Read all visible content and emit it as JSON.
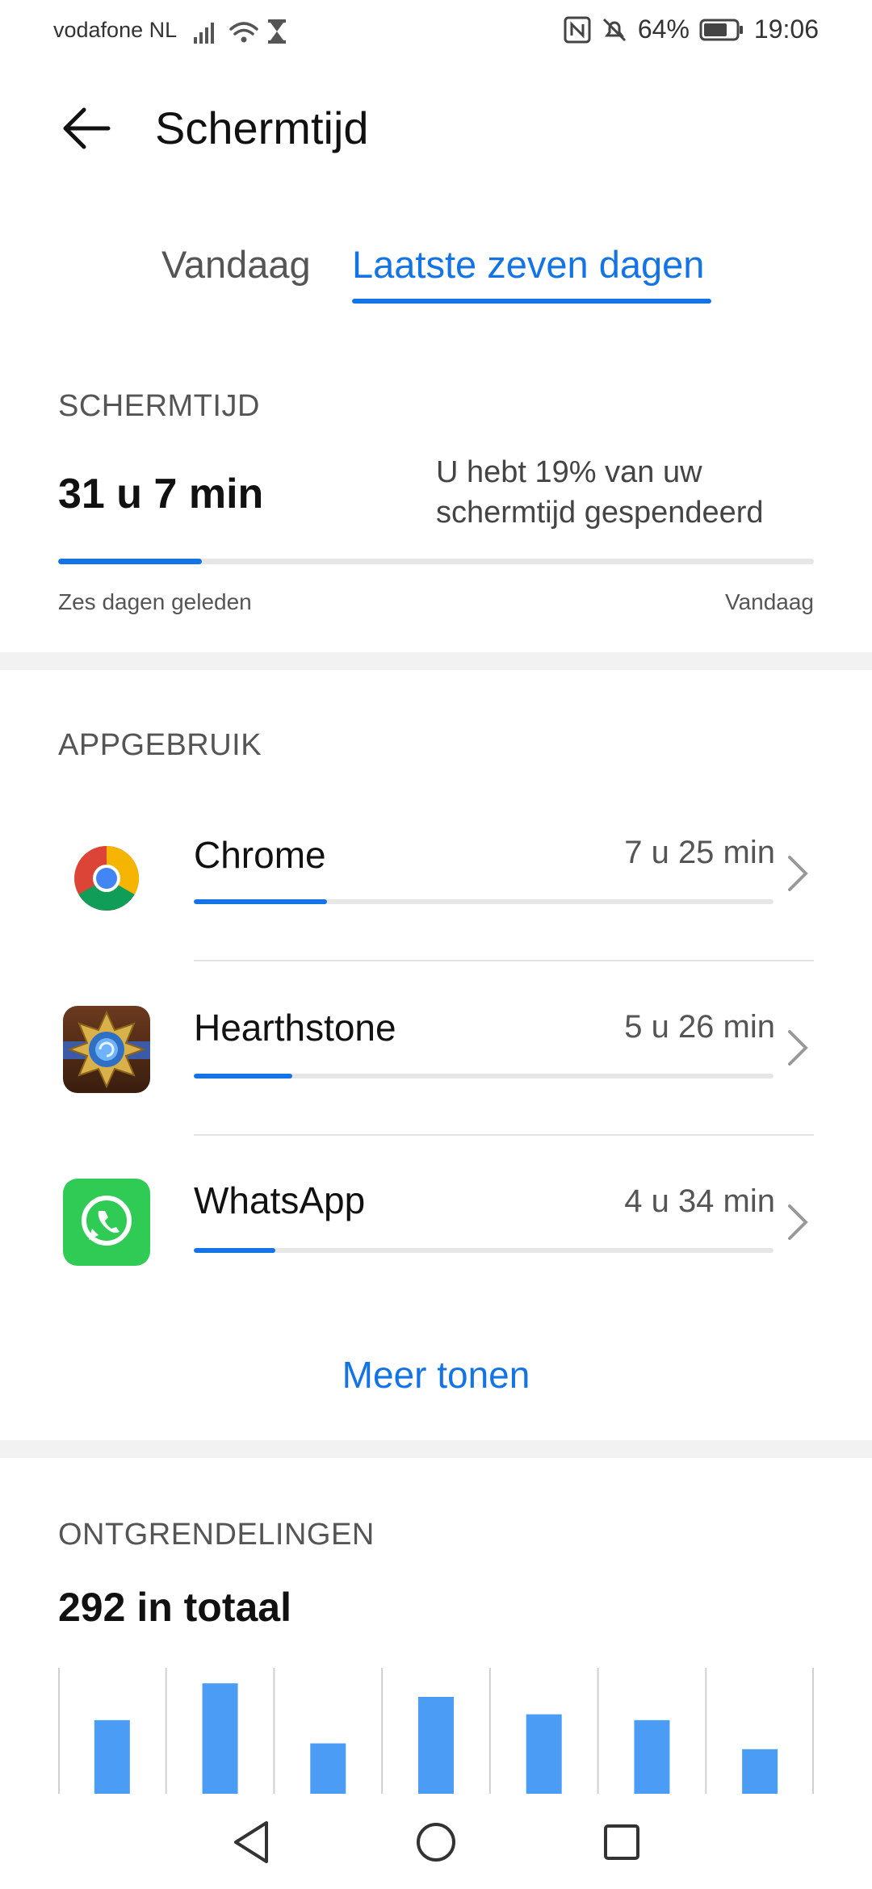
{
  "status_bar": {
    "carrier": "vodafone NL",
    "battery": "64%",
    "time": "19:06"
  },
  "header": {
    "title": "Schermtijd"
  },
  "tabs": [
    {
      "label": "Vandaag",
      "active": false
    },
    {
      "label": "Laatste zeven dagen",
      "active": true
    }
  ],
  "screen_time": {
    "section_label": "SCHERMTIJD",
    "total": "31 u 7 min",
    "percent_text": "U hebt 19% van uw schermtijd gespendeerd",
    "percent": 0.19,
    "range_start": "Zes dagen geleden",
    "range_end": "Vandaag"
  },
  "app_usage": {
    "section_label": "APPGEBRUIK",
    "apps": [
      {
        "name": "Chrome",
        "time": "7 u 25 min",
        "icon": "chrome-icon",
        "fraction": 0.23
      },
      {
        "name": "Hearthstone",
        "time": "5 u 26 min",
        "icon": "hearthstone-icon",
        "fraction": 0.17
      },
      {
        "name": "WhatsApp",
        "time": "4 u 34 min",
        "icon": "whatsapp-icon",
        "fraction": 0.14
      }
    ],
    "more_label": "Meer tonen"
  },
  "unlocks": {
    "section_label": "ONTGRENDELINGEN",
    "total": "292 in totaal"
  },
  "chart_data": {
    "type": "bar",
    "values": [
      38,
      57,
      26,
      50,
      41,
      38,
      23
    ],
    "ylim": [
      0,
      65
    ],
    "grid": true,
    "bar_color": "#4a9cf5"
  },
  "colors": {
    "accent": "#1474e6",
    "track": "#e6e6e6"
  }
}
